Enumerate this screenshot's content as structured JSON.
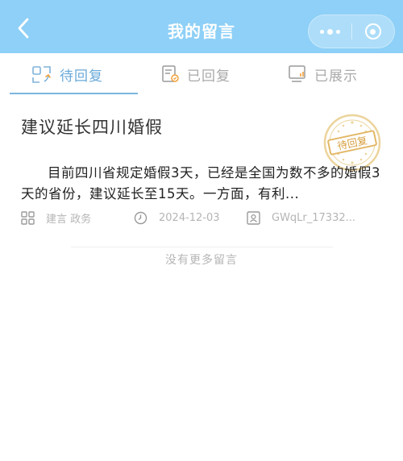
{
  "header": {
    "title": "我的留言",
    "colors": {
      "background": "#8ed0f7",
      "text": "#ffffff"
    }
  },
  "tabs": [
    {
      "label": "待回复",
      "icon": "pending-reply-icon",
      "active": true
    },
    {
      "label": "已回复",
      "icon": "replied-document-icon",
      "active": false
    },
    {
      "label": "已展示",
      "icon": "displayed-screen-icon",
      "active": false
    }
  ],
  "message": {
    "title": "建议延长四川婚假",
    "status_stamp": "待回复",
    "body": "目前四川省规定婚假3天，已经是全国为数不多的婚假3天的省份，建议延长至15天。一方面，有利...",
    "category": "建言 政务",
    "date": "2024-12-03",
    "user": "GWqLr_17332..."
  },
  "footer": {
    "no_more": "没有更多留言"
  },
  "colors": {
    "accent": "#6aa9d8",
    "muted": "#b5b5b5",
    "stamp": "#e9cf92"
  }
}
